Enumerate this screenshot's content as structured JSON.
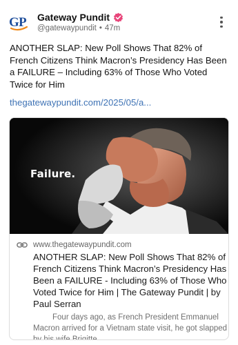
{
  "author": {
    "avatar_text": "GP",
    "name": "Gateway Pundit",
    "handle": "@gatewaypundit",
    "time": "47m",
    "verified": true
  },
  "post": {
    "text": "ANOTHER SLAP: New Poll Shows That 82% of French Citizens Think Macron’s Presidency Has Been a FAILURE – Including 63% of Those Who Voted Twice for Him",
    "link": "thegatewaypundit.com/2025/05/a..."
  },
  "card": {
    "image_caption": "Failure.",
    "domain": "www.thegatewaypundit.com",
    "title": "ANOTHER SLAP: New Poll Shows That 82% of French Citizens Think Macron’s Presidency Has Been a FAILURE - Including 63% of Those Who Voted Twice for Him | The Gateway Pundit | by Paul Serran",
    "description": "Four days ago, as French President Emmanuel Macron arrived for a Vietnam state visit, he got slapped by his wife Brigitte."
  },
  "colors": {
    "link": "#3f73b5",
    "avatar_blue": "#1f4f9c",
    "avatar_orange": "#f08a1a",
    "verified": "#e8457a"
  },
  "icons": {
    "verified": "verified-badge-icon",
    "more": "more-vertical-icon",
    "link": "link-icon"
  }
}
